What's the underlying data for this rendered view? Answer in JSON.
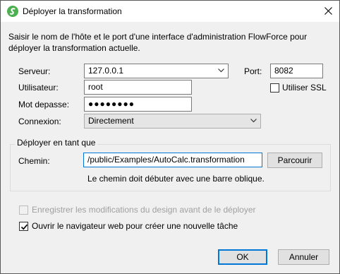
{
  "window": {
    "title": "Déployer la transformation",
    "icon": "altova-green-s-icon"
  },
  "description": "Saisir le nom de l'hôte et le port d'une interface d'administration FlowForce pour déployer la transformation actuelle.",
  "server": {
    "label": "Serveur:",
    "value": "127.0.0.1",
    "port_label": "Port:",
    "port_value": "8082",
    "ssl_label": "Utiliser SSL",
    "ssl_checked": false
  },
  "user": {
    "label": "Utilisateur:",
    "value": "root"
  },
  "password": {
    "label": "Mot depasse:",
    "value": "●●●●●●●●"
  },
  "connection": {
    "label": "Connexion:",
    "value": "Directement"
  },
  "deploy_as": {
    "group_label": "Déployer en tant que",
    "path_label": "Chemin:",
    "path_value": "/public/Examples/AutoCalc.transformation",
    "browse_label": "Parcourir",
    "hint": "Le chemin doit débuter avec une barre oblique."
  },
  "options": {
    "save_label": "Enregistrer les modifications du design avant de le déployer",
    "save_enabled": false,
    "save_checked": false,
    "open_browser_label": "Ouvrir le navigateur web pour créer une nouvelle tâche",
    "open_browser_checked": true
  },
  "buttons": {
    "ok": "OK",
    "cancel": "Annuler"
  },
  "colors": {
    "focus_border": "#0078d7",
    "icon_green": "#4caf50"
  }
}
